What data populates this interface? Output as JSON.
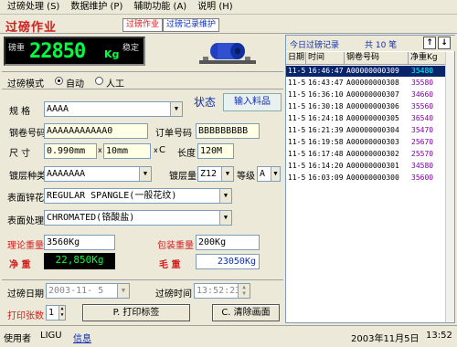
{
  "menu": [
    {
      "label": "过磅处理 (S)"
    },
    {
      "label": "数据维护 (P)"
    },
    {
      "label": "辅助功能 (A)"
    },
    {
      "label": "说明 (H)"
    }
  ],
  "header": {
    "title": "过磅作业",
    "tab_weigh": "过磅作业",
    "tab_records": "过磅记录维护"
  },
  "scale": {
    "label": "磅重",
    "value": "22850",
    "unit": "Kg",
    "stable": "稳定"
  },
  "mode": {
    "label": "过磅模式",
    "auto": "自动",
    "manual": "人工",
    "selected": "auto"
  },
  "form": {
    "spec_label": "规  格",
    "spec_value": "AAAA",
    "status_label": "状态",
    "input_btn": "输入料品",
    "coil_label": "钢卷号码",
    "coil_value": "AAAAAAAAAAA0",
    "order_label": "订单号码",
    "order_value": "BBBBBBBBB",
    "size_label": "尺  寸",
    "thickness": "0.990mm",
    "x1": "x",
    "width": "10mm",
    "x2": "x",
    "c": "C",
    "length_label": "长度",
    "length_value": "120M",
    "coating_type_label": "镀层种类",
    "coating_type_value": "AAAAAAA",
    "coating_amt_label": "镀层量",
    "coating_amt_value": "Z12",
    "grade_label": "等级",
    "grade_value": "A",
    "spangle_label": "表面锌花",
    "spangle_value": "REGULAR SPANGLE(一般花纹)",
    "treat_label": "表面处理",
    "treat_value": "CHROMATED(铬酸盐)",
    "theory_label": "理论重量",
    "theory_value": "3560Kg",
    "pack_label": "包装重量",
    "pack_value": "200Kg",
    "net_label": "净  重",
    "net_value": "22,850Kg",
    "gross_label": "毛  重",
    "gross_value": "23050Kg"
  },
  "bottom": {
    "date_label": "过磅日期",
    "date_value": "2003-11- 5",
    "time_label": "过磅时间",
    "time_value": "13:52:23",
    "copies_label": "打印张数",
    "copies_value": "1",
    "print_btn": "P. 打印标签",
    "clear_btn": "C. 清除画面"
  },
  "records": {
    "title": "今日过磅记录",
    "count": "共 10 笔",
    "up": "↑",
    "down": "↓",
    "columns": [
      "日期",
      "时间",
      "钢卷号码",
      "净重Kg"
    ],
    "rows": [
      [
        "11-5",
        "16:46:47",
        "A00000000309",
        "35480"
      ],
      [
        "11-5",
        "16:43:47",
        "A00000000308",
        "35580"
      ],
      [
        "11-5",
        "16:36:10",
        "A00000000307",
        "34660"
      ],
      [
        "11-5",
        "16:30:18",
        "A00000000306",
        "35560"
      ],
      [
        "11-5",
        "16:24:18",
        "A00000000305",
        "36540"
      ],
      [
        "11-5",
        "16:21:39",
        "A00000000304",
        "35470"
      ],
      [
        "11-5",
        "16:19:58",
        "A00000000303",
        "25670"
      ],
      [
        "11-5",
        "16:17:48",
        "A00000000302",
        "25570"
      ],
      [
        "11-5",
        "16:14:20",
        "A00000000301",
        "34580"
      ],
      [
        "11-5",
        "16:03:09",
        "A00000000300",
        "35600"
      ]
    ],
    "selected_index": 0
  },
  "statusbar": {
    "user_label": "使用者",
    "user_value": "LIGU",
    "info": "信息",
    "datetime": "2003年11月5日",
    "time": "13:52"
  },
  "colors": {
    "accent_red": "#d02020",
    "label_blue": "#1030b0",
    "lcd_green": "#00ff40",
    "select_blue": "#0a246a"
  }
}
